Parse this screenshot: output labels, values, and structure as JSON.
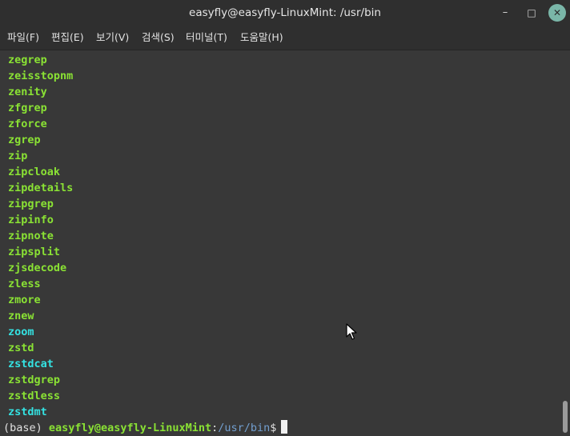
{
  "window": {
    "title": "easyfly@easyfly-LinuxMint: /usr/bin",
    "minimize_glyph": "–",
    "maximize_glyph": "□",
    "close_glyph": "✕"
  },
  "menu": {
    "items": [
      {
        "label": "파일(F)"
      },
      {
        "label": "편집(E)"
      },
      {
        "label": "보기(V)"
      },
      {
        "label": "검색(S)"
      },
      {
        "label": "터미널(T)"
      },
      {
        "label": "도움말(H)"
      }
    ]
  },
  "terminal": {
    "lines": [
      {
        "text": "zegrep",
        "type": "exec"
      },
      {
        "text": "zeisstopnm",
        "type": "exec"
      },
      {
        "text": "zenity",
        "type": "exec"
      },
      {
        "text": "zfgrep",
        "type": "exec"
      },
      {
        "text": "zforce",
        "type": "exec"
      },
      {
        "text": "zgrep",
        "type": "exec"
      },
      {
        "text": "zip",
        "type": "exec"
      },
      {
        "text": "zipcloak",
        "type": "exec"
      },
      {
        "text": "zipdetails",
        "type": "exec"
      },
      {
        "text": "zipgrep",
        "type": "exec"
      },
      {
        "text": "zipinfo",
        "type": "exec"
      },
      {
        "text": "zipnote",
        "type": "exec"
      },
      {
        "text": "zipsplit",
        "type": "exec"
      },
      {
        "text": "zjsdecode",
        "type": "exec"
      },
      {
        "text": "zless",
        "type": "exec"
      },
      {
        "text": "zmore",
        "type": "exec"
      },
      {
        "text": "znew",
        "type": "exec"
      },
      {
        "text": "zoom",
        "type": "link"
      },
      {
        "text": "zstd",
        "type": "exec"
      },
      {
        "text": "zstdcat",
        "type": "link"
      },
      {
        "text": "zstdgrep",
        "type": "exec"
      },
      {
        "text": "zstdless",
        "type": "exec"
      },
      {
        "text": "zstdmt",
        "type": "link"
      }
    ],
    "prompt": {
      "env": "(base)",
      "user_host": "easyfly@easyfly-LinuxMint",
      "colon": ":",
      "path": "/usr/bin",
      "dollar": "$"
    }
  },
  "colors": {
    "executable": "#8ae234",
    "symlink": "#34e2e2",
    "path": "#729fcf",
    "background": "#383838",
    "close_button": "#7ab6a8"
  }
}
